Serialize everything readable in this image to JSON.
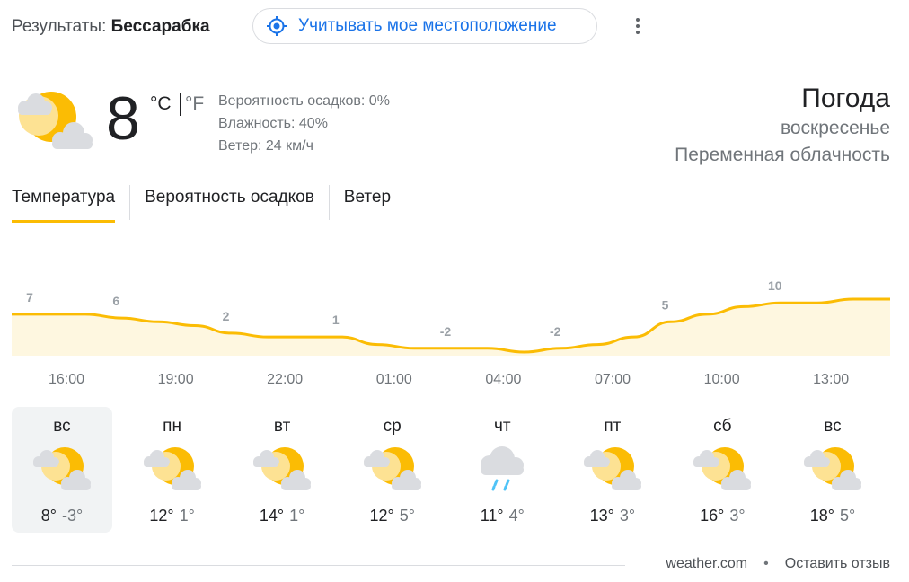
{
  "header": {
    "results_prefix": "Результаты:",
    "results_location": "Бессарабка",
    "location_button_label": "Учитывать мое местоположение"
  },
  "current": {
    "icon": "partly-cloudy-icon",
    "temperature": "8",
    "unit_c": "°C",
    "unit_f": "°F",
    "precip": "Вероятность осадков: 0%",
    "humidity": "Влажность: 40%",
    "wind": "Ветер: 24 км/ч",
    "title": "Погода",
    "day": "воскресенье",
    "condition": "Переменная облачность"
  },
  "tabs": [
    {
      "label": "Температура",
      "active": true
    },
    {
      "label": "Вероятность осадков",
      "active": false
    },
    {
      "label": "Ветер",
      "active": false
    }
  ],
  "chart_data": {
    "type": "area",
    "x": [
      "16:00",
      "17:00",
      "18:00",
      "19:00",
      "20:00",
      "21:00",
      "22:00",
      "23:00",
      "00:00",
      "01:00",
      "02:00",
      "03:00",
      "04:00",
      "05:00",
      "06:00",
      "07:00",
      "08:00",
      "09:00",
      "10:00",
      "11:00",
      "12:00",
      "13:00",
      "14:00",
      "15:00",
      "16:00"
    ],
    "values": [
      7,
      7,
      7,
      6,
      5,
      4,
      2,
      1,
      1,
      1,
      -1,
      -2,
      -2,
      -2,
      -3,
      -2,
      -1,
      1,
      5,
      7,
      9,
      10,
      10,
      11,
      11
    ],
    "labels": [
      {
        "index": 0,
        "text": "7"
      },
      {
        "index": 3,
        "text": "6"
      },
      {
        "index": 6,
        "text": "2"
      },
      {
        "index": 9,
        "text": "1"
      },
      {
        "index": 12,
        "text": "-2"
      },
      {
        "index": 15,
        "text": "-2"
      },
      {
        "index": 18,
        "text": "5"
      },
      {
        "index": 21,
        "text": "10"
      }
    ],
    "tick_labels": [
      "16:00",
      "19:00",
      "22:00",
      "01:00",
      "04:00",
      "07:00",
      "10:00",
      "13:00"
    ],
    "line_color": "#fbbc04",
    "fill_color": "#fef7e0"
  },
  "days": [
    {
      "name": "вс",
      "icon": "partly-cloudy-icon",
      "high": "8°",
      "low": "-3°",
      "selected": true
    },
    {
      "name": "пн",
      "icon": "partly-cloudy-icon",
      "high": "12°",
      "low": "1°",
      "selected": false
    },
    {
      "name": "вт",
      "icon": "partly-cloudy-icon",
      "high": "14°",
      "low": "1°",
      "selected": false
    },
    {
      "name": "ср",
      "icon": "partly-cloudy-icon",
      "high": "12°",
      "low": "5°",
      "selected": false
    },
    {
      "name": "чт",
      "icon": "rain-icon",
      "high": "11°",
      "low": "4°",
      "selected": false
    },
    {
      "name": "пт",
      "icon": "partly-cloudy-icon",
      "high": "13°",
      "low": "3°",
      "selected": false
    },
    {
      "name": "сб",
      "icon": "partly-cloudy-icon",
      "high": "16°",
      "low": "3°",
      "selected": false
    },
    {
      "name": "вс",
      "icon": "partly-cloudy-icon",
      "high": "18°",
      "low": "5°",
      "selected": false
    }
  ],
  "footer": {
    "source": "weather.com",
    "separator": "•",
    "feedback": "Оставить отзыв"
  }
}
